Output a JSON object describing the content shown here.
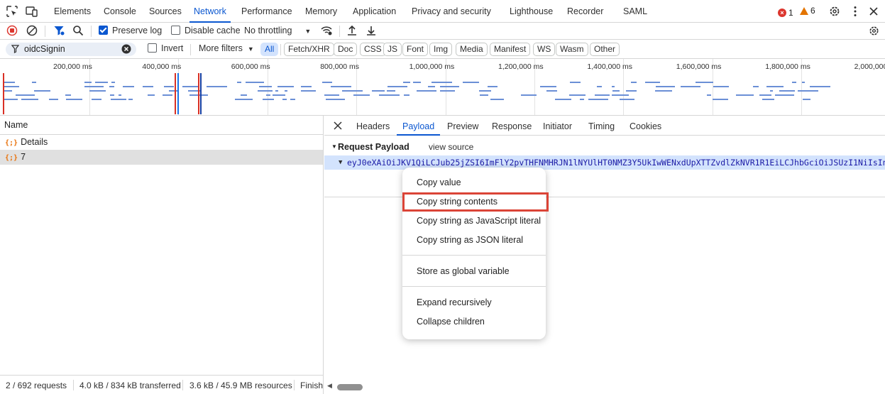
{
  "tabs": [
    "Elements",
    "Console",
    "Sources",
    "Network",
    "Performance",
    "Memory",
    "Application",
    "Privacy and security",
    "Lighthouse",
    "Recorder",
    "SAML"
  ],
  "active_tab": "Network",
  "issues": {
    "errors": "1",
    "warnings": "6"
  },
  "toolbar": {
    "preserve_log": "Preserve log",
    "disable_cache": "Disable cache",
    "throttling": "No throttling"
  },
  "filter": {
    "value": "oidcSignin",
    "invert": "Invert",
    "more_filters": "More filters",
    "types": [
      "All",
      "Fetch/XHR",
      "Doc",
      "CSS",
      "JS",
      "Font",
      "Img",
      "Media",
      "Manifest",
      "WS",
      "Wasm",
      "Other"
    ]
  },
  "overview": {
    "ticks": [
      "200,000 ms",
      "400,000 ms",
      "600,000 ms",
      "800,000 ms",
      "1,000,000 ms",
      "1,200,000 ms",
      "1,400,000 ms",
      "1,600,000 ms",
      "1,800,000 ms",
      "2,000,000 ms"
    ]
  },
  "requests": {
    "header": "Name",
    "rows": [
      {
        "icon": "{;}",
        "name": "Details"
      },
      {
        "icon": "{;}",
        "name": "7"
      }
    ]
  },
  "status": {
    "requests": "2 / 692 requests",
    "transferred": "4.0 kB / 834 kB transferred",
    "resources": "3.6 kB / 45.9 MB resources",
    "finish": "Finish"
  },
  "details": {
    "tabs": [
      "Headers",
      "Payload",
      "Preview",
      "Response",
      "Initiator",
      "Timing",
      "Cookies"
    ],
    "active_tab": "Payload",
    "payload_title": "Request Payload",
    "view_source": "view source",
    "payload_value": "eyJ0eXAiOiJKV1QiLCJub25jZSI6ImFlY2pvTHFNMHRJN1lNYUlHT0NMZ3Y5UkIwWENxdUpXTTZvdlZkNVR1R1EiLCJhbGciOiJSUzI1NiIsInI"
  },
  "context_menu": {
    "items": [
      "Copy value",
      "Copy string contents",
      "Copy string as JavaScript literal",
      "Copy string as JSON literal",
      "Store as global variable",
      "Expand recursively",
      "Collapse children"
    ],
    "highlighted": "Copy string contents"
  },
  "colors": {
    "accent": "#0b57d0",
    "highlight_box": "#db4437",
    "selection": "#d3e3fd"
  }
}
